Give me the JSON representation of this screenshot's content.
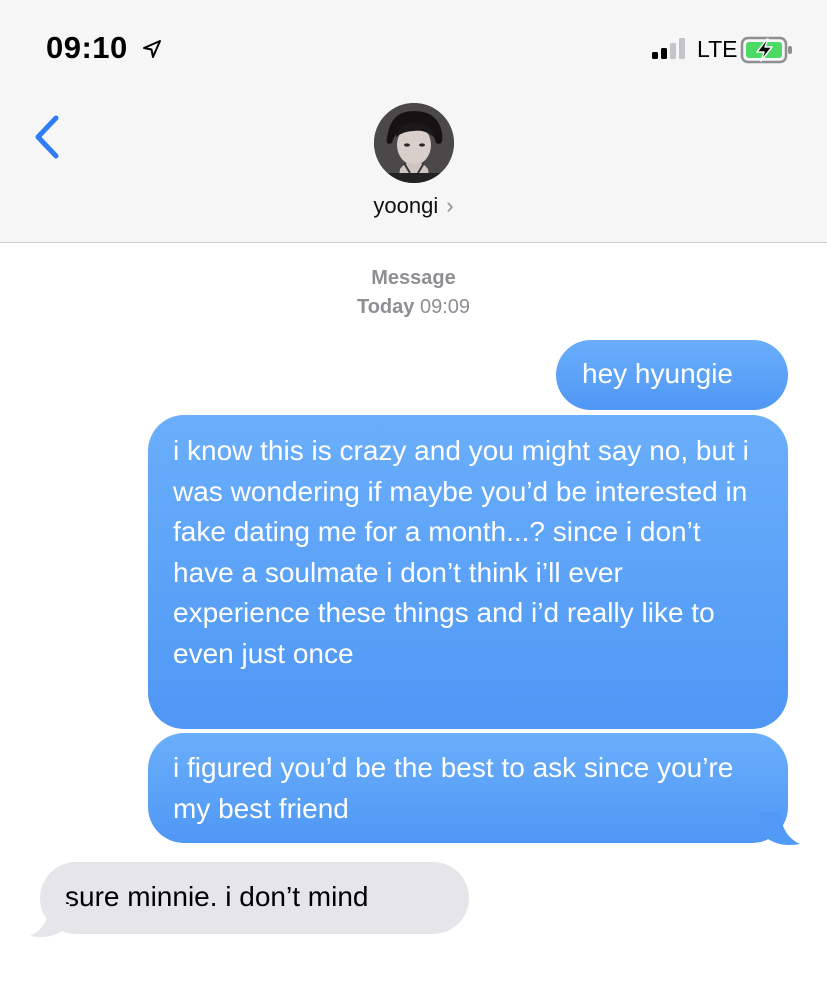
{
  "status_bar": {
    "time": "09:10",
    "network": "LTE",
    "icons": [
      "location-arrow-icon",
      "signal-bars-icon",
      "battery-charging-icon"
    ],
    "battery_color": "#4cd964"
  },
  "nav": {
    "back_icon": "chevron-left-icon",
    "contact_name": "yoongi",
    "contact_chevron": "›",
    "accent_color": "#2f7cf6"
  },
  "thread": {
    "service": "Message",
    "date_label": "Today",
    "time": "09:09",
    "messages": [
      {
        "direction": "outgoing",
        "text": "hey hyungie"
      },
      {
        "direction": "outgoing",
        "text": "i know this is crazy and you might say no, but i was wondering if maybe you’d be interested in fake dating me for a month...? since i don’t have a soulmate i don’t think i’ll ever experience these things and i’d really like to even just once"
      },
      {
        "direction": "outgoing",
        "text": "i figured you’d be the best to ask since you’re my best friend"
      },
      {
        "direction": "incoming",
        "text": "sure minnie. i don’t mind"
      }
    ],
    "outgoing_color": "#5ba0f7",
    "incoming_color": "#e5e5ea"
  }
}
